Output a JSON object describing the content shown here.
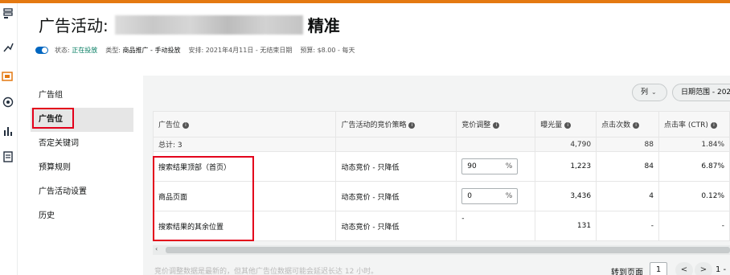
{
  "header": {
    "title_prefix": "广告活动: ",
    "title_suffix": "精准"
  },
  "meta": {
    "status_label": "状态: ",
    "status_value": "正在投放",
    "type_label": "类型: ",
    "type_value": "商品推广 - 手动投放",
    "schedule": "安排: 2021年4月11日 - 无结束日期",
    "budget": "预算: $8.00 - 每天"
  },
  "nav": {
    "items": [
      "广告组",
      "广告位",
      "否定关键词",
      "预算规则",
      "广告活动设置",
      "历史"
    ]
  },
  "toolbar": {
    "columns_label": "列",
    "date_range_label": "日期范围 - 202"
  },
  "table": {
    "headers": [
      "广告位",
      "广告活动的竞价策略",
      "竞价调整",
      "曝光量",
      "点击次数",
      "点击率 (CTR)"
    ],
    "total": {
      "label": "总计: 3",
      "impressions": "4,790",
      "clicks": "88",
      "ctr": "1.84%"
    },
    "rows": [
      {
        "placement": "搜索结果顶部（首页）",
        "strategy": "动态竞价 - 只降低",
        "bid_adjust": "90",
        "impressions": "1,223",
        "clicks": "84",
        "ctr": "6.87%"
      },
      {
        "placement": "商品页面",
        "strategy": "动态竞价 - 只降低",
        "bid_adjust": "0",
        "impressions": "3,436",
        "clicks": "4",
        "ctr": "0.12%"
      },
      {
        "placement": "搜索结果的其余位置",
        "strategy": "动态竞价 - 只降低",
        "bid_adjust": "-",
        "impressions": "131",
        "clicks": "-",
        "ctr": "-"
      }
    ],
    "percent_sign": "%"
  },
  "footer": {
    "note": "竞价调整数据是最新的，但其他广告位数据可能会延迟长达 12 小时。",
    "goto_label": "转到页面",
    "page": "1",
    "prev": "<",
    "next": ">",
    "range": "1 -"
  },
  "colors": {
    "accent_orange": "#e47911",
    "highlight_red": "#e3001b",
    "status_green": "#067d62",
    "toggle_blue": "#0066c0"
  }
}
